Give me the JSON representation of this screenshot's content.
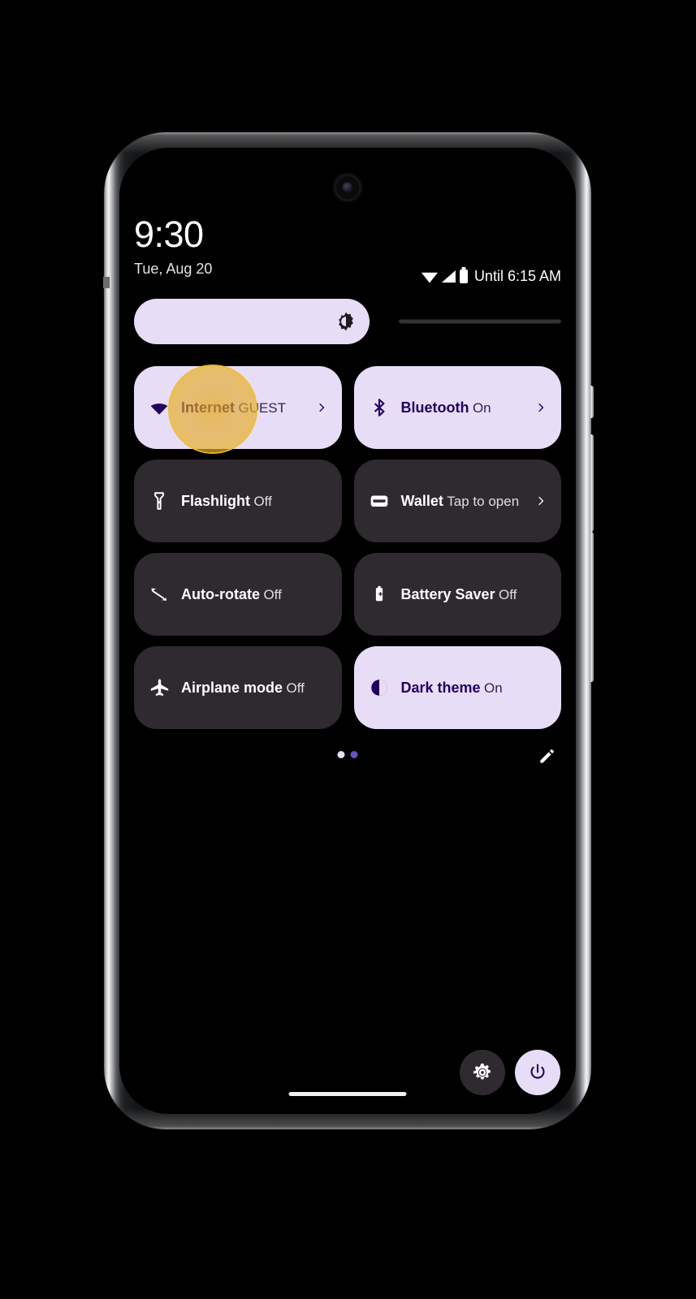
{
  "statusbar": {
    "time": "9:30",
    "date": "Tue, Aug 20",
    "battery_text": "Until 6:15 AM",
    "icons": [
      "wifi-icon",
      "cellular-signal-icon",
      "battery-icon"
    ]
  },
  "brightness": {
    "name": "brightness-slider",
    "icon": "brightness-icon",
    "value_percent": 55
  },
  "tiles": [
    {
      "label": "Internet",
      "state": "GUEST",
      "icon": "wifi-icon",
      "active": true,
      "chevron": true
    },
    {
      "label": "Bluetooth",
      "state": "On",
      "icon": "bluetooth-icon",
      "active": true,
      "chevron": true
    },
    {
      "label": "Flashlight",
      "state": "Off",
      "icon": "flashlight-icon",
      "active": false,
      "chevron": false
    },
    {
      "label": "Wallet",
      "state": "Tap to open",
      "icon": "wallet-icon",
      "active": false,
      "chevron": true
    },
    {
      "label": "Auto-rotate",
      "state": "Off",
      "icon": "auto-rotate-icon",
      "active": false,
      "chevron": false
    },
    {
      "label": "Battery Saver",
      "state": "Off",
      "icon": "battery-saver-icon",
      "active": false,
      "chevron": false
    },
    {
      "label": "Airplane mode",
      "state": "Off",
      "icon": "airplane-icon",
      "active": false,
      "chevron": false
    },
    {
      "label": "Dark theme",
      "state": "On",
      "icon": "dark-theme-icon",
      "active": true,
      "chevron": false
    }
  ],
  "footer": {
    "page_dots": [
      "current",
      "other"
    ],
    "edit_icon": "pencil-edit-icon"
  },
  "actions": {
    "settings_icon": "gear-icon",
    "power_icon": "power-icon"
  },
  "colors": {
    "accent_active_tile": "#E8DDF7",
    "accent_active_text": "#21005D",
    "tile_inactive": "#2E2A2F",
    "touch_highlight": "#F0BA28",
    "page_dot_active": "#6C4FC2",
    "screen_background": "#000000"
  }
}
